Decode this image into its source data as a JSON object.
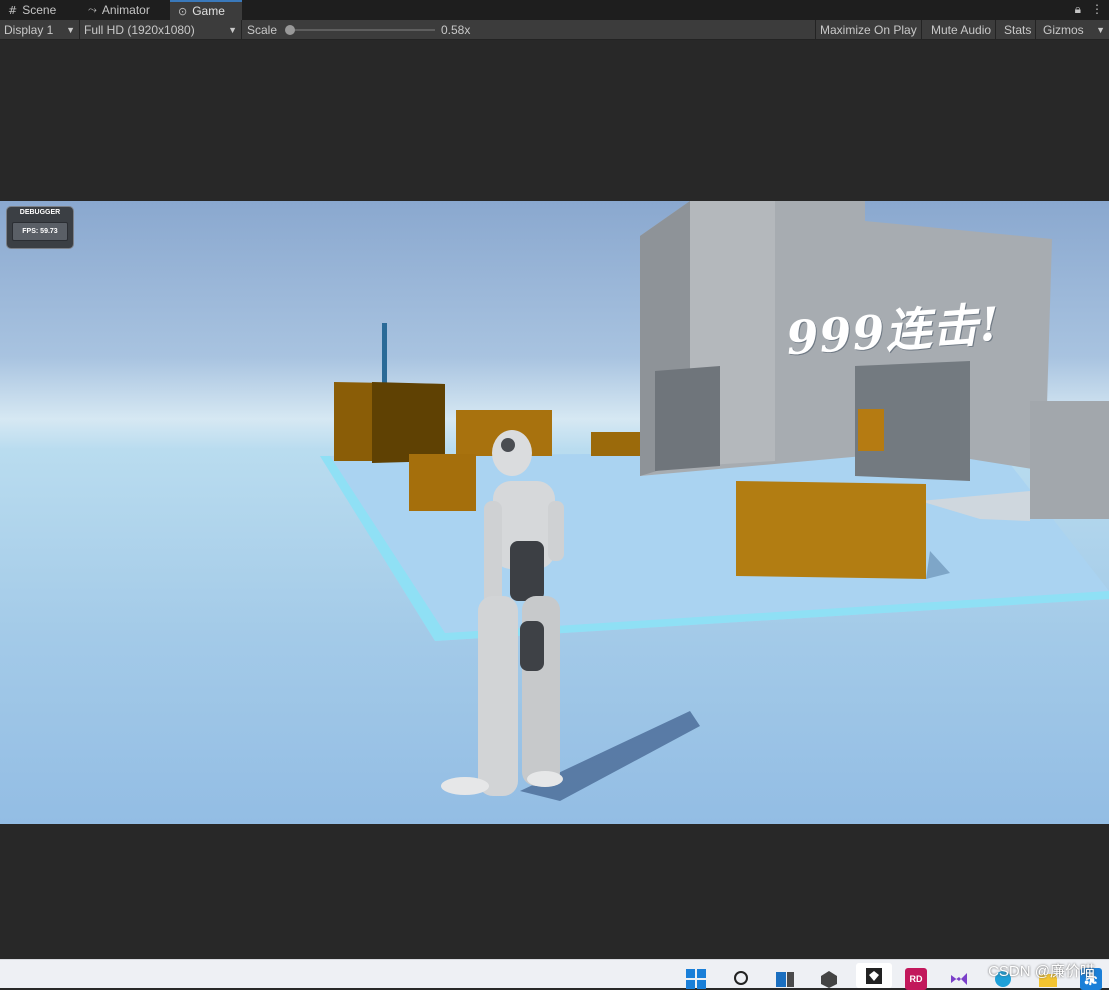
{
  "tabs": [
    {
      "label": "Scene",
      "icon": "grid-icon"
    },
    {
      "label": "Animator",
      "icon": "animator-icon"
    },
    {
      "label": "Game",
      "icon": "gamepad-icon"
    }
  ],
  "toolbar": {
    "display": "Display 1",
    "resolution": "Full HD (1920x1080)",
    "scale_label": "Scale",
    "scale_value": "0.58x",
    "maximize": "Maximize On Play",
    "mute": "Mute Audio",
    "stats": "Stats",
    "gizmos": "Gizmos"
  },
  "debugger": {
    "title": "DEBUGGER",
    "fps": "FPS: 59.73"
  },
  "overlay": {
    "combo_text": "999连击!"
  },
  "taskbar": {
    "watermark": "CSDN @廉价喵"
  },
  "colors": {
    "accent": "#3a79bb",
    "crate": "#b07a10",
    "wall": "#9ea3a8",
    "floor": "#a8d0ee",
    "sky": "#8aa8cf"
  }
}
